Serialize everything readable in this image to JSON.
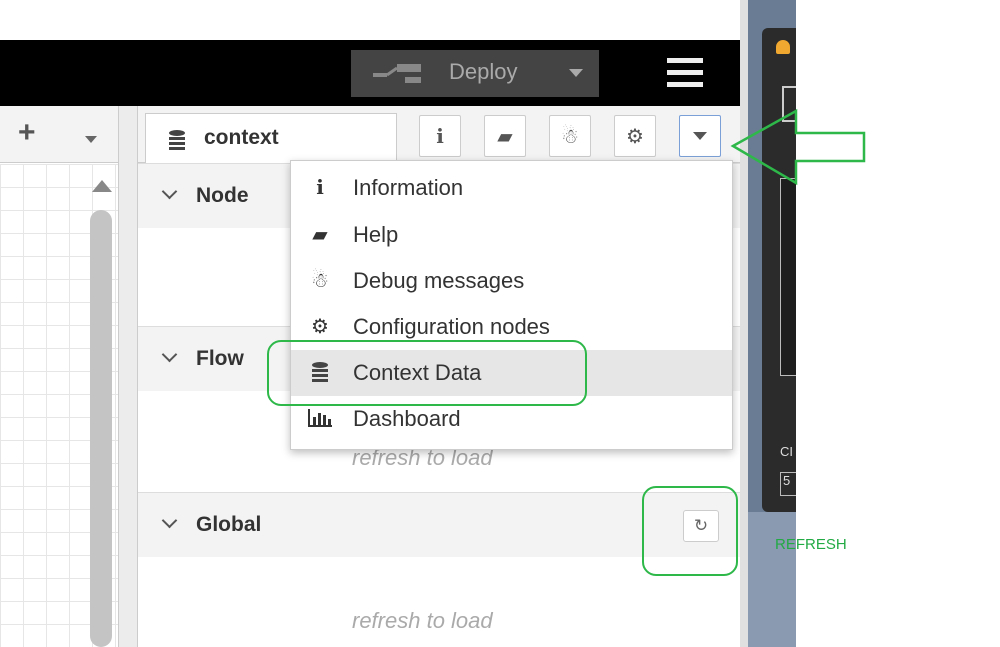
{
  "header": {
    "deploy_label": "Deploy"
  },
  "sidebar": {
    "active_tab": "context",
    "tab_icons": [
      "info-icon",
      "book-icon",
      "bug-icon",
      "gear-icon",
      "caret-down-icon"
    ],
    "sections": [
      {
        "title": "Node",
        "empty_text": ""
      },
      {
        "title": "Flow",
        "empty_text": "refresh to load"
      },
      {
        "title": "Global",
        "empty_text": "refresh to load"
      }
    ]
  },
  "menu": {
    "items": [
      {
        "icon": "info-icon",
        "label": "Information"
      },
      {
        "icon": "book-icon",
        "label": "Help"
      },
      {
        "icon": "bug-icon",
        "label": "Debug messages"
      },
      {
        "icon": "gear-icon",
        "label": "Configuration nodes"
      },
      {
        "icon": "database-icon",
        "label": "Context Data",
        "selected": true
      },
      {
        "icon": "bar-chart-icon",
        "label": "Dashboard"
      }
    ]
  },
  "annotations": {
    "refresh_note": "REFRESH",
    "highlight_color": "#2eb84a"
  },
  "right_window": {
    "label_1": "CI",
    "label_2": "5"
  }
}
